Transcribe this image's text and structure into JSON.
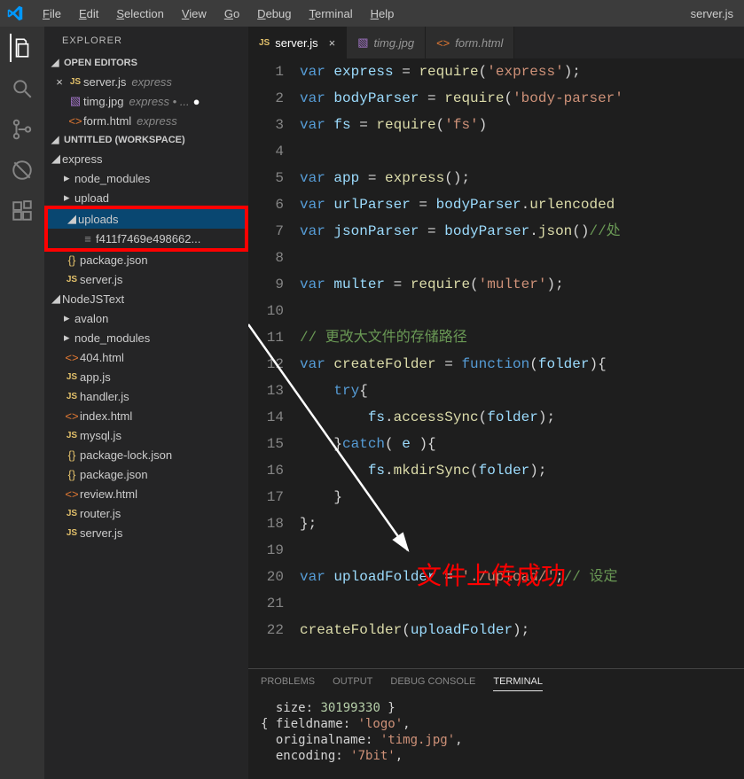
{
  "titlebar": {
    "menus": [
      "File",
      "Edit",
      "Selection",
      "View",
      "Go",
      "Debug",
      "Terminal",
      "Help"
    ],
    "filename": "server.js"
  },
  "activitybar": {
    "items": [
      {
        "name": "explorer",
        "active": true
      },
      {
        "name": "search",
        "active": false
      },
      {
        "name": "scm",
        "active": false
      },
      {
        "name": "debug",
        "active": false
      },
      {
        "name": "extensions",
        "active": false
      }
    ]
  },
  "sidebar": {
    "title": "EXPLORER",
    "open_editors": {
      "label": "OPEN EDITORS",
      "items": [
        {
          "close": "×",
          "glyph": "JS",
          "glyph_class": "js-glyph",
          "label": "server.js",
          "desc": "express",
          "modified": false
        },
        {
          "close": "",
          "glyph": "▧",
          "glyph_class": "img-glyph",
          "label": "timg.jpg",
          "desc": "express • ...",
          "modified": true
        },
        {
          "close": "",
          "glyph": "<>",
          "glyph_class": "html-glyph",
          "label": "form.html",
          "desc": "express",
          "modified": false
        }
      ]
    },
    "workspace": {
      "label": "UNTITLED (WORKSPACE)",
      "tree": [
        {
          "depth": 0,
          "type": "folder",
          "open": true,
          "label": "express",
          "glyph": "",
          "glyph_class": ""
        },
        {
          "depth": 1,
          "type": "folder",
          "open": false,
          "label": "node_modules",
          "glyph": "",
          "glyph_class": ""
        },
        {
          "depth": 1,
          "type": "folder",
          "open": false,
          "label": "upload",
          "glyph": "",
          "glyph_class": ""
        },
        {
          "depth": 1,
          "type": "folder",
          "open": true,
          "label": "uploads",
          "glyph": "",
          "glyph_class": "",
          "selected": true,
          "highlight": "start"
        },
        {
          "depth": 2,
          "type": "file",
          "label": "f411f7469e498662...",
          "glyph": "≡",
          "glyph_class": "file-glyph",
          "highlight": "end"
        },
        {
          "depth": 1,
          "type": "file",
          "label": "package.json",
          "glyph": "{}",
          "glyph_class": "json-glyph"
        },
        {
          "depth": 1,
          "type": "file",
          "label": "server.js",
          "glyph": "JS",
          "glyph_class": "js-glyph"
        },
        {
          "depth": 0,
          "type": "folder",
          "open": true,
          "label": "NodeJSText",
          "glyph": "",
          "glyph_class": ""
        },
        {
          "depth": 1,
          "type": "folder",
          "open": false,
          "label": "avalon",
          "glyph": "",
          "glyph_class": ""
        },
        {
          "depth": 1,
          "type": "folder",
          "open": false,
          "label": "node_modules",
          "glyph": "",
          "glyph_class": ""
        },
        {
          "depth": 1,
          "type": "file",
          "label": "404.html",
          "glyph": "<>",
          "glyph_class": "html-glyph"
        },
        {
          "depth": 1,
          "type": "file",
          "label": "app.js",
          "glyph": "JS",
          "glyph_class": "js-glyph"
        },
        {
          "depth": 1,
          "type": "file",
          "label": "handler.js",
          "glyph": "JS",
          "glyph_class": "js-glyph"
        },
        {
          "depth": 1,
          "type": "file",
          "label": "index.html",
          "glyph": "<>",
          "glyph_class": "html-glyph"
        },
        {
          "depth": 1,
          "type": "file",
          "label": "mysql.js",
          "glyph": "JS",
          "glyph_class": "js-glyph"
        },
        {
          "depth": 1,
          "type": "file",
          "label": "package-lock.json",
          "glyph": "{}",
          "glyph_class": "json-glyph"
        },
        {
          "depth": 1,
          "type": "file",
          "label": "package.json",
          "glyph": "{}",
          "glyph_class": "json-glyph"
        },
        {
          "depth": 1,
          "type": "file",
          "label": "review.html",
          "glyph": "<>",
          "glyph_class": "html-glyph"
        },
        {
          "depth": 1,
          "type": "file",
          "label": "router.js",
          "glyph": "JS",
          "glyph_class": "js-glyph"
        },
        {
          "depth": 1,
          "type": "file",
          "label": "server.js",
          "glyph": "JS",
          "glyph_class": "js-glyph"
        }
      ]
    }
  },
  "editor": {
    "tabs": [
      {
        "glyph": "JS",
        "glyph_class": "js-glyph",
        "label": "server.js",
        "active": true,
        "close": "×"
      },
      {
        "glyph": "▧",
        "glyph_class": "img-glyph",
        "label": "timg.jpg",
        "active": false,
        "close": ""
      },
      {
        "glyph": "<>",
        "glyph_class": "html-glyph",
        "label": "form.html",
        "active": false,
        "close": ""
      }
    ],
    "code": [
      [
        {
          "t": "var ",
          "c": "kw"
        },
        {
          "t": "express",
          "c": "lit"
        },
        {
          "t": " = ",
          "c": "pun"
        },
        {
          "t": "require",
          "c": "fn"
        },
        {
          "t": "(",
          "c": "pun"
        },
        {
          "t": "'express'",
          "c": "str"
        },
        {
          "t": ");",
          "c": "pun"
        }
      ],
      [
        {
          "t": "var ",
          "c": "kw"
        },
        {
          "t": "bodyParser",
          "c": "lit"
        },
        {
          "t": " = ",
          "c": "pun"
        },
        {
          "t": "require",
          "c": "fn"
        },
        {
          "t": "(",
          "c": "pun"
        },
        {
          "t": "'body-parser'",
          "c": "str"
        }
      ],
      [
        {
          "t": "var ",
          "c": "kw"
        },
        {
          "t": "fs",
          "c": "lit"
        },
        {
          "t": " = ",
          "c": "pun"
        },
        {
          "t": "require",
          "c": "fn"
        },
        {
          "t": "(",
          "c": "pun"
        },
        {
          "t": "'fs'",
          "c": "str"
        },
        {
          "t": ")",
          "c": "pun"
        }
      ],
      [],
      [
        {
          "t": "var ",
          "c": "kw"
        },
        {
          "t": "app",
          "c": "lit"
        },
        {
          "t": " = ",
          "c": "pun"
        },
        {
          "t": "express",
          "c": "fn"
        },
        {
          "t": "();",
          "c": "pun"
        }
      ],
      [
        {
          "t": "var ",
          "c": "kw"
        },
        {
          "t": "urlParser",
          "c": "lit"
        },
        {
          "t": " = ",
          "c": "pun"
        },
        {
          "t": "bodyParser",
          "c": "lit"
        },
        {
          "t": ".",
          "c": "pun"
        },
        {
          "t": "urlencoded",
          "c": "fn"
        }
      ],
      [
        {
          "t": "var ",
          "c": "kw"
        },
        {
          "t": "jsonParser",
          "c": "lit"
        },
        {
          "t": " = ",
          "c": "pun"
        },
        {
          "t": "bodyParser",
          "c": "lit"
        },
        {
          "t": ".",
          "c": "pun"
        },
        {
          "t": "json",
          "c": "fn"
        },
        {
          "t": "()",
          "c": "pun"
        },
        {
          "t": "//处",
          "c": "cmt"
        }
      ],
      [],
      [
        {
          "t": "var ",
          "c": "kw"
        },
        {
          "t": "multer",
          "c": "lit"
        },
        {
          "t": " = ",
          "c": "pun"
        },
        {
          "t": "require",
          "c": "fn"
        },
        {
          "t": "(",
          "c": "pun"
        },
        {
          "t": "'multer'",
          "c": "str"
        },
        {
          "t": ");",
          "c": "pun"
        }
      ],
      [],
      [
        {
          "t": "// 更改大文件的存储路径",
          "c": "cmt"
        }
      ],
      [
        {
          "t": "var ",
          "c": "kw"
        },
        {
          "t": "createFolder",
          "c": "fn"
        },
        {
          "t": " = ",
          "c": "pun"
        },
        {
          "t": "function",
          "c": "kw"
        },
        {
          "t": "(",
          "c": "pun"
        },
        {
          "t": "folder",
          "c": "param"
        },
        {
          "t": "){",
          "c": "pun"
        }
      ],
      [
        {
          "t": "    ",
          "c": ""
        },
        {
          "t": "try",
          "c": "kw"
        },
        {
          "t": "{",
          "c": "pun"
        }
      ],
      [
        {
          "t": "        ",
          "c": ""
        },
        {
          "t": "fs",
          "c": "lit"
        },
        {
          "t": ".",
          "c": "pun"
        },
        {
          "t": "accessSync",
          "c": "fn"
        },
        {
          "t": "(",
          "c": "pun"
        },
        {
          "t": "folder",
          "c": "lit"
        },
        {
          "t": ");",
          "c": "pun"
        }
      ],
      [
        {
          "t": "    }",
          "c": "pun"
        },
        {
          "t": "catch",
          "c": "kw"
        },
        {
          "t": "( ",
          "c": "pun"
        },
        {
          "t": "e",
          "c": "lit"
        },
        {
          "t": " ){",
          "c": "pun"
        }
      ],
      [
        {
          "t": "        ",
          "c": ""
        },
        {
          "t": "fs",
          "c": "lit"
        },
        {
          "t": ".",
          "c": "pun"
        },
        {
          "t": "mkdirSync",
          "c": "fn"
        },
        {
          "t": "(",
          "c": "pun"
        },
        {
          "t": "folder",
          "c": "lit"
        },
        {
          "t": ");",
          "c": "pun"
        }
      ],
      [
        {
          "t": "    }",
          "c": "pun"
        }
      ],
      [
        {
          "t": "};",
          "c": "pun"
        }
      ],
      [],
      [
        {
          "t": "var ",
          "c": "kw"
        },
        {
          "t": "uploadFolder",
          "c": "lit"
        },
        {
          "t": " = ",
          "c": "pun"
        },
        {
          "t": "'./upload/'",
          "c": "str"
        },
        {
          "t": ";",
          "c": "pun"
        },
        {
          "t": "// 设定",
          "c": "cmt"
        }
      ],
      [],
      [
        {
          "t": "createFolder",
          "c": "fn"
        },
        {
          "t": "(",
          "c": "pun"
        },
        {
          "t": "uploadFolder",
          "c": "lit"
        },
        {
          "t": ");",
          "c": "pun"
        }
      ]
    ],
    "annotation": "文件上传成功"
  },
  "panel": {
    "tabs": [
      "PROBLEMS",
      "OUTPUT",
      "DEBUG CONSOLE",
      "TERMINAL"
    ],
    "active_tab": 3,
    "lines": [
      [
        {
          "t": "  size: ",
          "c": "tkey"
        },
        {
          "t": "30199330",
          "c": "tnum"
        },
        {
          "t": " }",
          "c": "tkey"
        }
      ],
      [
        {
          "t": "{ fieldname: ",
          "c": "tkey"
        },
        {
          "t": "'logo'",
          "c": "tstr"
        },
        {
          "t": ",",
          "c": "tkey"
        }
      ],
      [
        {
          "t": "  originalname: ",
          "c": "tkey"
        },
        {
          "t": "'timg.jpg'",
          "c": "tstr"
        },
        {
          "t": ",",
          "c": "tkey"
        }
      ],
      [
        {
          "t": "  encoding: ",
          "c": "tkey"
        },
        {
          "t": "'7bit'",
          "c": "tstr"
        },
        {
          "t": ",",
          "c": "tkey"
        }
      ]
    ]
  }
}
